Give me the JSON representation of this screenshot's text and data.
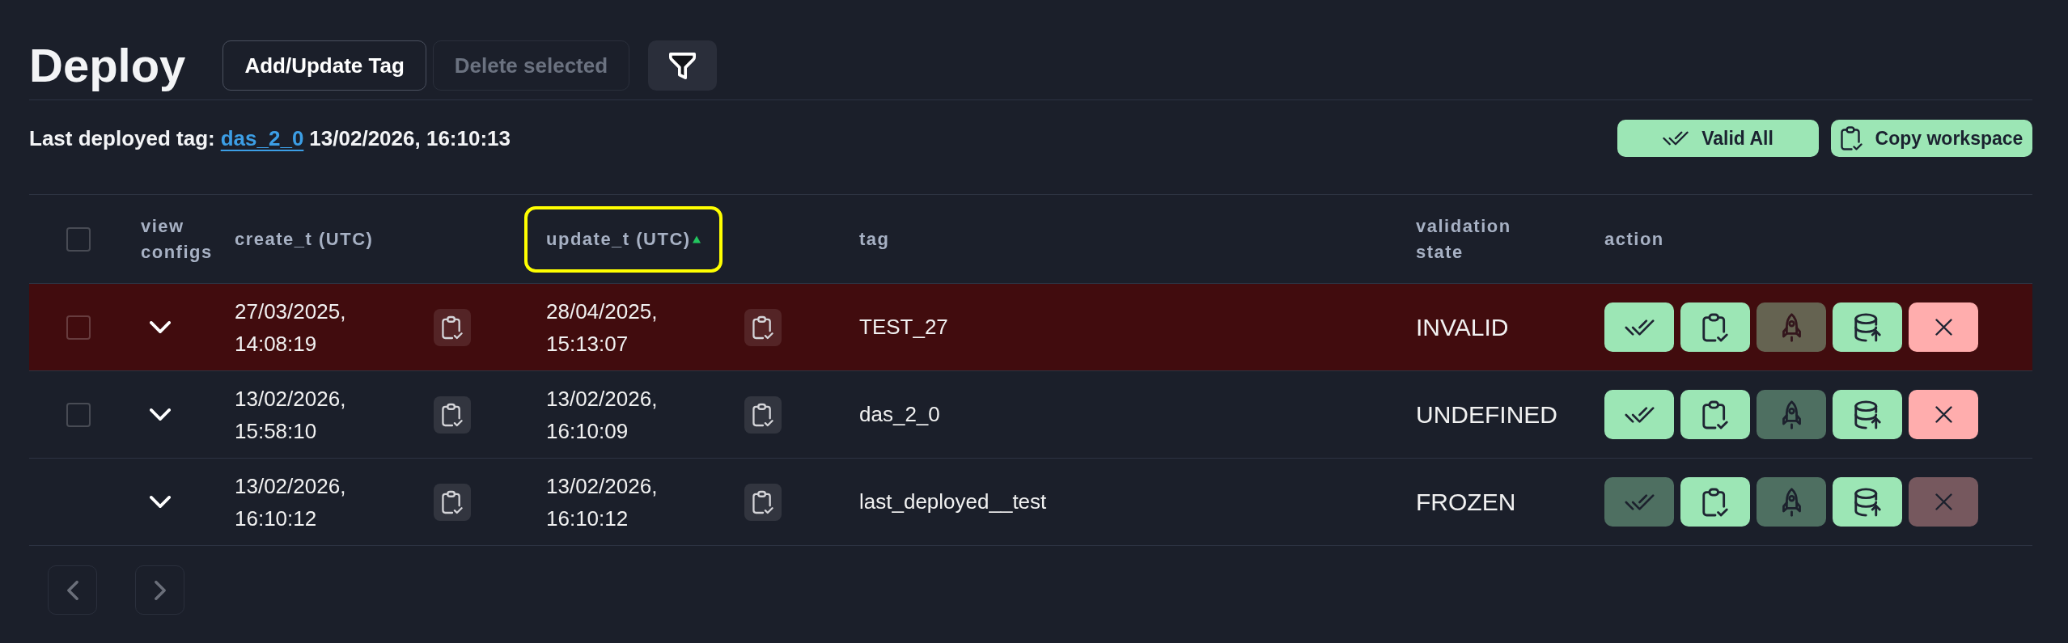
{
  "page": {
    "title": "Deploy"
  },
  "toolbar": {
    "buttons": [
      {
        "label": "Add/Update Tag",
        "disabled": false
      },
      {
        "label": "Delete selected",
        "disabled": true
      }
    ]
  },
  "last_deployed": {
    "label": "Last deployed tag:",
    "tag": "das_2_0",
    "time": "13/02/2026, 16:10:13"
  },
  "bulk_actions": [
    {
      "kind": "validate",
      "label": "Valid All"
    },
    {
      "kind": "copy",
      "label": "Copy workspace"
    }
  ],
  "table": {
    "select_all": {
      "checked": false
    },
    "columns": [
      {
        "kind": "plain",
        "label": "view configs"
      },
      {
        "kind": "sortable",
        "label": "create_t (UTC)",
        "sorted": false,
        "highlighted": false
      },
      {
        "kind": "sortable",
        "label": "update_t (UTC)",
        "sorted": true,
        "highlighted": true
      },
      {
        "kind": "plain",
        "label": "tag"
      },
      {
        "kind": "plain",
        "label": "validation state"
      },
      {
        "kind": "plain",
        "label": "action"
      }
    ],
    "rows": [
      {
        "checkbox": {
          "checked": false
        },
        "expanded": false,
        "alert": true,
        "created": "27/03/2025, 14:08:19",
        "updated": "28/04/2025, 15:13:07",
        "tag": "TEST_27",
        "validation_state": "INVALID",
        "actions": [
          {
            "kind": "validate",
            "disabled": false
          },
          {
            "kind": "copy",
            "disabled": false
          },
          {
            "kind": "deploy",
            "disabled": true
          },
          {
            "kind": "upload",
            "disabled": false
          },
          {
            "kind": "delete",
            "disabled": false
          }
        ]
      },
      {
        "checkbox": {
          "checked": false
        },
        "expanded": false,
        "alert": false,
        "created": "13/02/2026, 15:58:10",
        "updated": "13/02/2026, 16:10:09",
        "tag": "das_2_0",
        "validation_state": "UNDEFINED",
        "actions": [
          {
            "kind": "validate",
            "disabled": false
          },
          {
            "kind": "copy",
            "disabled": false
          },
          {
            "kind": "deploy",
            "disabled": true
          },
          {
            "kind": "upload",
            "disabled": false
          },
          {
            "kind": "delete",
            "disabled": false
          }
        ]
      },
      {
        "expanded": false,
        "alert": false,
        "created": "13/02/2026, 16:10:12",
        "updated": "13/02/2026, 16:10:12",
        "tag": "last_deployed__test",
        "validation_state": "FROZEN",
        "actions": [
          {
            "kind": "validate",
            "disabled": true
          },
          {
            "kind": "copy",
            "disabled": false
          },
          {
            "kind": "deploy",
            "disabled": true
          },
          {
            "kind": "upload",
            "disabled": false
          },
          {
            "kind": "delete",
            "disabled": true
          }
        ]
      }
    ]
  },
  "pagination": [
    {
      "kind": "previous",
      "disabled": true
    },
    {
      "kind": "next",
      "disabled": true
    }
  ]
}
